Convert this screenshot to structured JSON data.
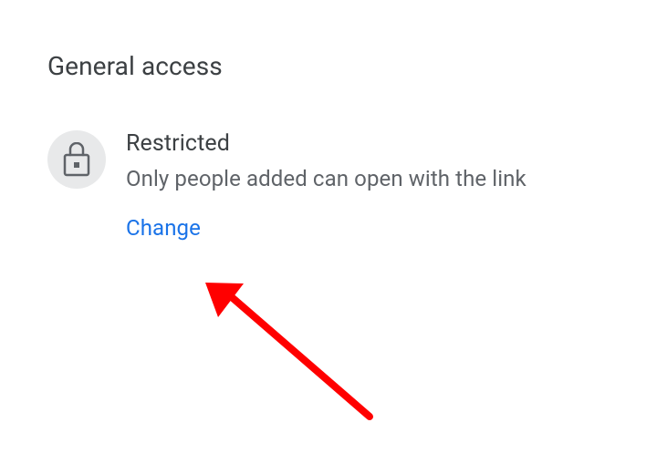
{
  "section": {
    "title": "General access"
  },
  "access": {
    "level": "Restricted",
    "description": "Only people added can open with the link",
    "change_label": "Change"
  }
}
